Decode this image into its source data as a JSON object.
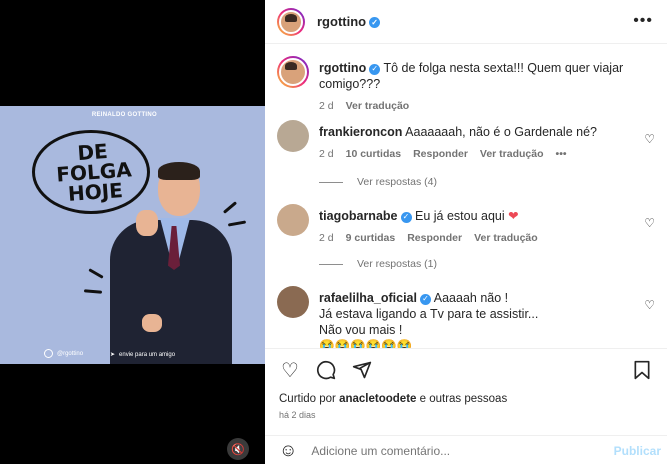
{
  "post_image": {
    "brand": "REINALDO GOTTINO",
    "headline": [
      "DE",
      "FOLGA",
      "HOJE"
    ],
    "footer_handle": "@rgottino",
    "footer_share": "envie para um amigo"
  },
  "header": {
    "username": "rgottino",
    "more": "•••"
  },
  "caption": {
    "username": "rgottino",
    "text": "Tô de folga nesta sexta!!! Quem quer viajar comigo???",
    "time": "2 d",
    "translate": "Ver tradução"
  },
  "comments": [
    {
      "username": "frankieroncon",
      "text": "Aaaaaaah, não é o Gardenale né?",
      "time": "2 d",
      "likes": "10 curtidas",
      "reply": "Responder",
      "translate": "Ver tradução",
      "more": "•••",
      "view_replies": "Ver respostas (4)"
    },
    {
      "username": "tiagobarnabe",
      "text": "Eu já estou aqui",
      "time": "2 d",
      "likes": "9 curtidas",
      "reply": "Responder",
      "translate": "Ver tradução",
      "view_replies": "Ver respostas (1)"
    },
    {
      "username": "rafaelilha_oficial",
      "line1": "Aaaaah não !",
      "line2": "Já estava ligando a Tv para te assistir...",
      "line3": "Não vou mais !",
      "emojis": "😭😭😭😭😭😭"
    }
  ],
  "footer": {
    "liked_prefix": "Curtido por",
    "liked_user": "anacletoodete",
    "liked_suffix": "e outras pessoas",
    "ago": "há 2 dias",
    "comment_placeholder": "Adicione um comentário...",
    "publish": "Publicar"
  },
  "colors": {
    "verified": "#3897f0",
    "accent_heart": "#ed4956",
    "publish_disabled": "#b2dffc",
    "image_bg": "#a9b9de"
  }
}
